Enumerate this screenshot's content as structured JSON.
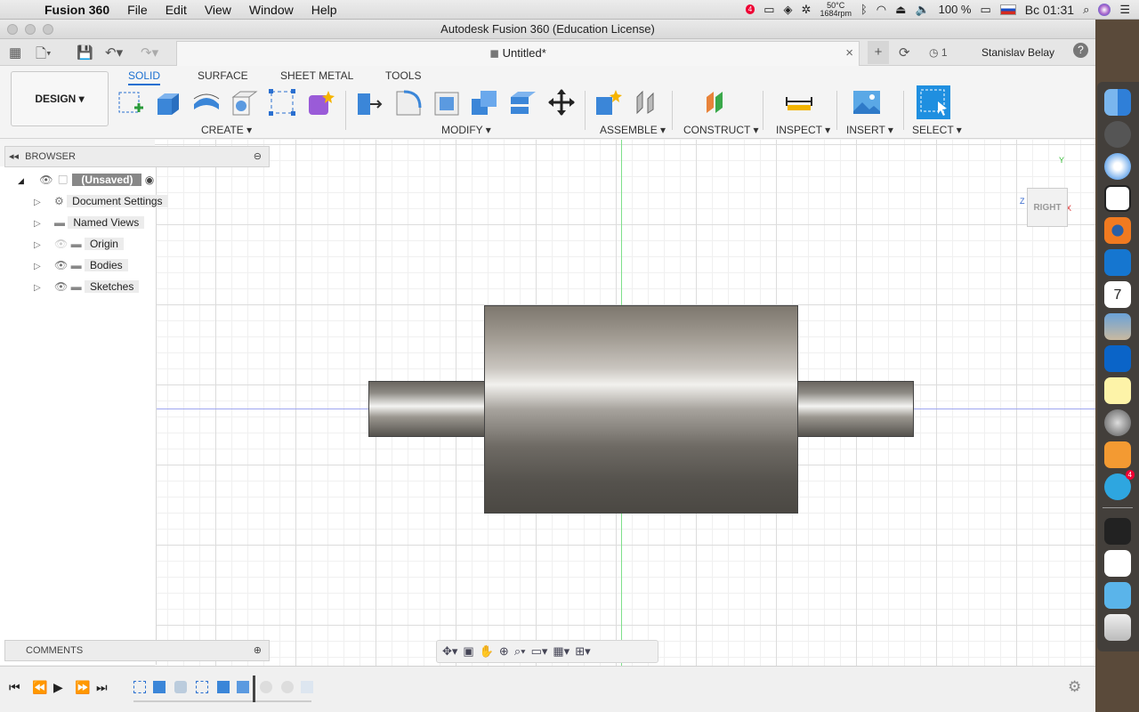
{
  "menubar": {
    "app_name": "Fusion 360",
    "items": [
      "File",
      "Edit",
      "View",
      "Window",
      "Help"
    ],
    "notif_count": "4",
    "temp": "50°C",
    "rpm": "1684rpm",
    "battery": "100 %",
    "clock": "Вс 01:31"
  },
  "window": {
    "title": "Autodesk Fusion 360 (Education License)",
    "doc_tab": "Untitled*",
    "jobs_count": "1",
    "user": "Stanislav Belay"
  },
  "ribbon": {
    "workspace": "DESIGN",
    "tabs": [
      "SOLID",
      "SURFACE",
      "SHEET METAL",
      "TOOLS"
    ],
    "active_tab": "SOLID",
    "groups": [
      "CREATE",
      "MODIFY",
      "ASSEMBLE",
      "CONSTRUCT",
      "INSPECT",
      "INSERT",
      "SELECT"
    ]
  },
  "browser": {
    "title": "BROWSER",
    "root": "(Unsaved)",
    "items": [
      "Document Settings",
      "Named Views",
      "Origin",
      "Bodies",
      "Sketches"
    ]
  },
  "comments": {
    "title": "COMMENTS"
  },
  "viewcube": {
    "face": "RIGHT"
  },
  "dock": {
    "telegram_badge": "4",
    "calendar_day": "7"
  }
}
